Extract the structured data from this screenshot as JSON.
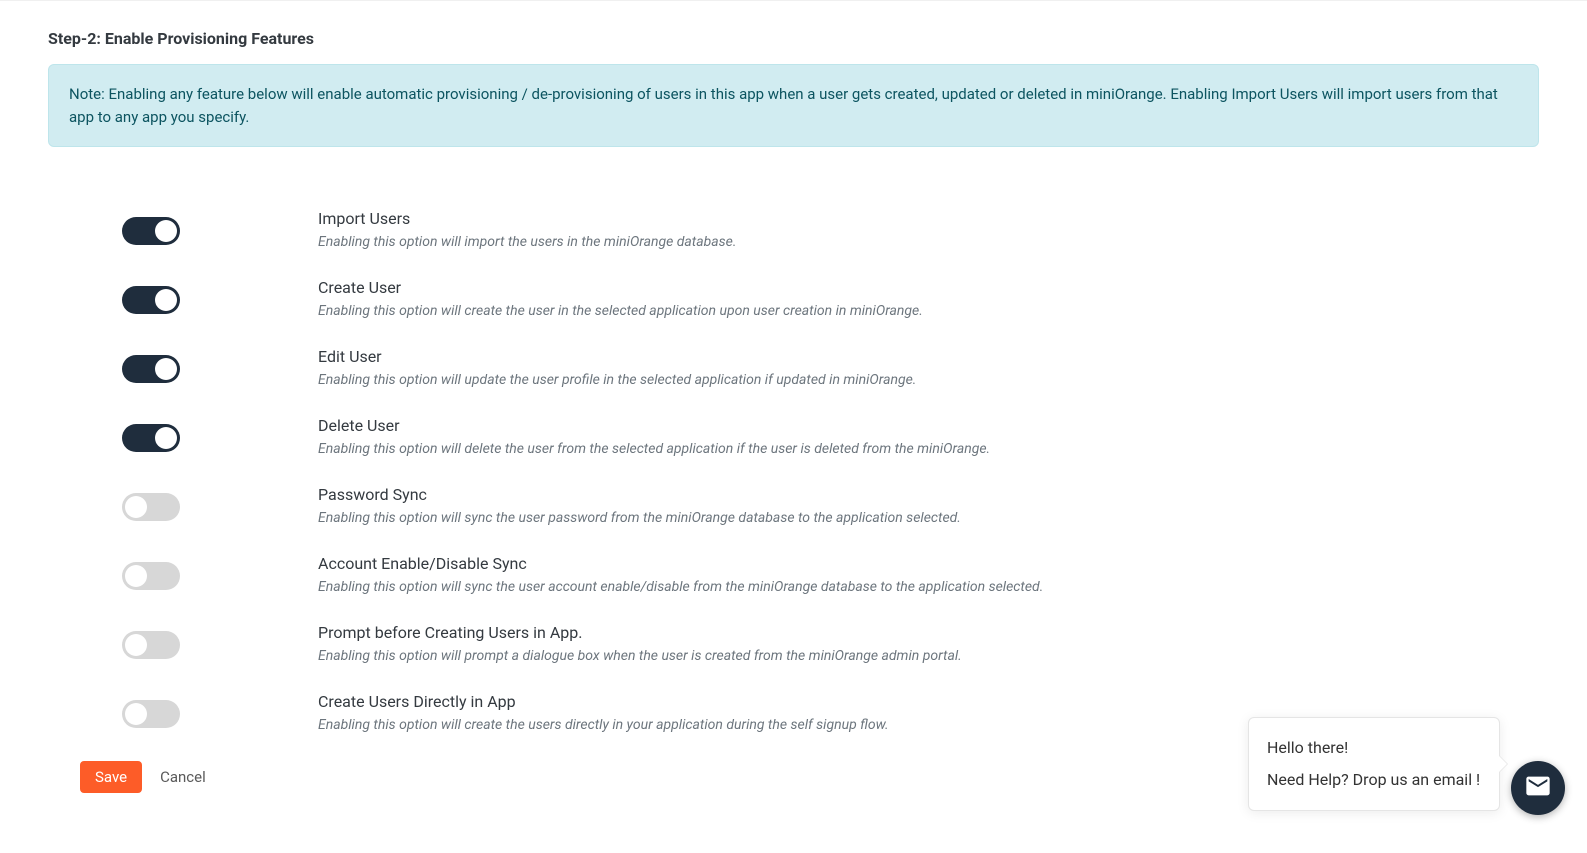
{
  "step_title": "Step-2: Enable Provisioning Features",
  "note": "Note: Enabling any feature below will enable automatic provisioning / de-provisioning of users in this app when a user gets created, updated or deleted in miniOrange. Enabling Import Users will import users from that app to any app you specify.",
  "features": [
    {
      "title": "Import Users",
      "desc": "Enabling this option will import the users in the miniOrange database.",
      "on": true
    },
    {
      "title": "Create User",
      "desc": "Enabling this option will create the user in the selected application upon user creation in miniOrange.",
      "on": true
    },
    {
      "title": "Edit User",
      "desc": "Enabling this option will update the user profile in the selected application if updated in miniOrange.",
      "on": true
    },
    {
      "title": "Delete User",
      "desc": "Enabling this option will delete the user from the selected application if the user is deleted from the miniOrange.",
      "on": true
    },
    {
      "title": "Password Sync",
      "desc": "Enabling this option will sync the user password from the miniOrange database to the application selected.",
      "on": false
    },
    {
      "title": "Account Enable/Disable Sync",
      "desc": "Enabling this option will sync the user account enable/disable from the miniOrange database to the application selected.",
      "on": false
    },
    {
      "title": "Prompt before Creating Users in App.",
      "desc": "Enabling this option will prompt a dialogue box when the user is created from the miniOrange admin portal.",
      "on": false
    },
    {
      "title": "Create Users Directly in App",
      "desc": "Enabling this option will create the users directly in your application during the self signup flow.",
      "on": false
    }
  ],
  "buttons": {
    "save": "Save",
    "cancel": "Cancel"
  },
  "help": {
    "line1": "Hello there!",
    "line2": "Need Help? Drop us an email !"
  }
}
